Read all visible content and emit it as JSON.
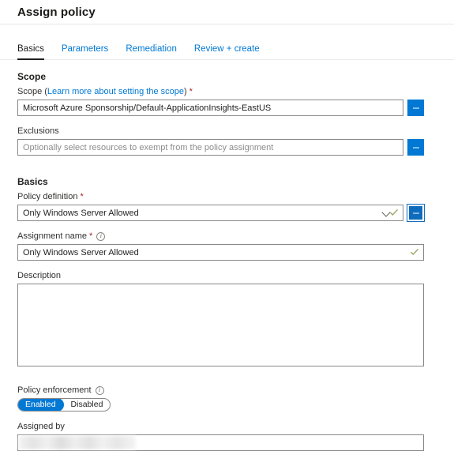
{
  "blade": {
    "title": "Assign policy"
  },
  "tabs": [
    {
      "label": "Basics",
      "active": true
    },
    {
      "label": "Parameters",
      "active": false
    },
    {
      "label": "Remediation",
      "active": false
    },
    {
      "label": "Review + create",
      "active": false
    }
  ],
  "scope_section": {
    "heading": "Scope",
    "scope_label_prefix": "Scope (",
    "scope_label_link": "Learn more about setting the scope",
    "scope_label_suffix": ")",
    "required_marker": "*",
    "scope_value": "Microsoft Azure Sponsorship/Default-ApplicationInsights-EastUS",
    "scope_browse_label": "...",
    "exclusions_label": "Exclusions",
    "exclusions_value": "",
    "exclusions_placeholder": "Optionally select resources to exempt from the policy assignment",
    "exclusions_browse_label": "..."
  },
  "basics_section": {
    "heading": "Basics",
    "policy_definition_label": "Policy definition",
    "policy_definition_required": "*",
    "policy_definition_value": "Only Windows Server Allowed",
    "policy_definition_browse_label": "...",
    "assignment_name_label": "Assignment name",
    "assignment_name_required": "*",
    "assignment_name_info": "info-icon",
    "assignment_name_value": "Only Windows Server Allowed",
    "description_label": "Description",
    "description_value": "",
    "policy_enforcement_label": "Policy enforcement",
    "policy_enforcement_info": "info-icon",
    "enforcement_enabled_label": "Enabled",
    "enforcement_disabled_label": "Disabled",
    "enforcement_selected": "Enabled",
    "assigned_by_label": "Assigned by",
    "assigned_by_value": ""
  },
  "colors": {
    "accent": "#0078d4",
    "required": "#a4262c",
    "valid_check": "#8a9a5b",
    "text": "#201f1e",
    "border": "#8a8886"
  }
}
